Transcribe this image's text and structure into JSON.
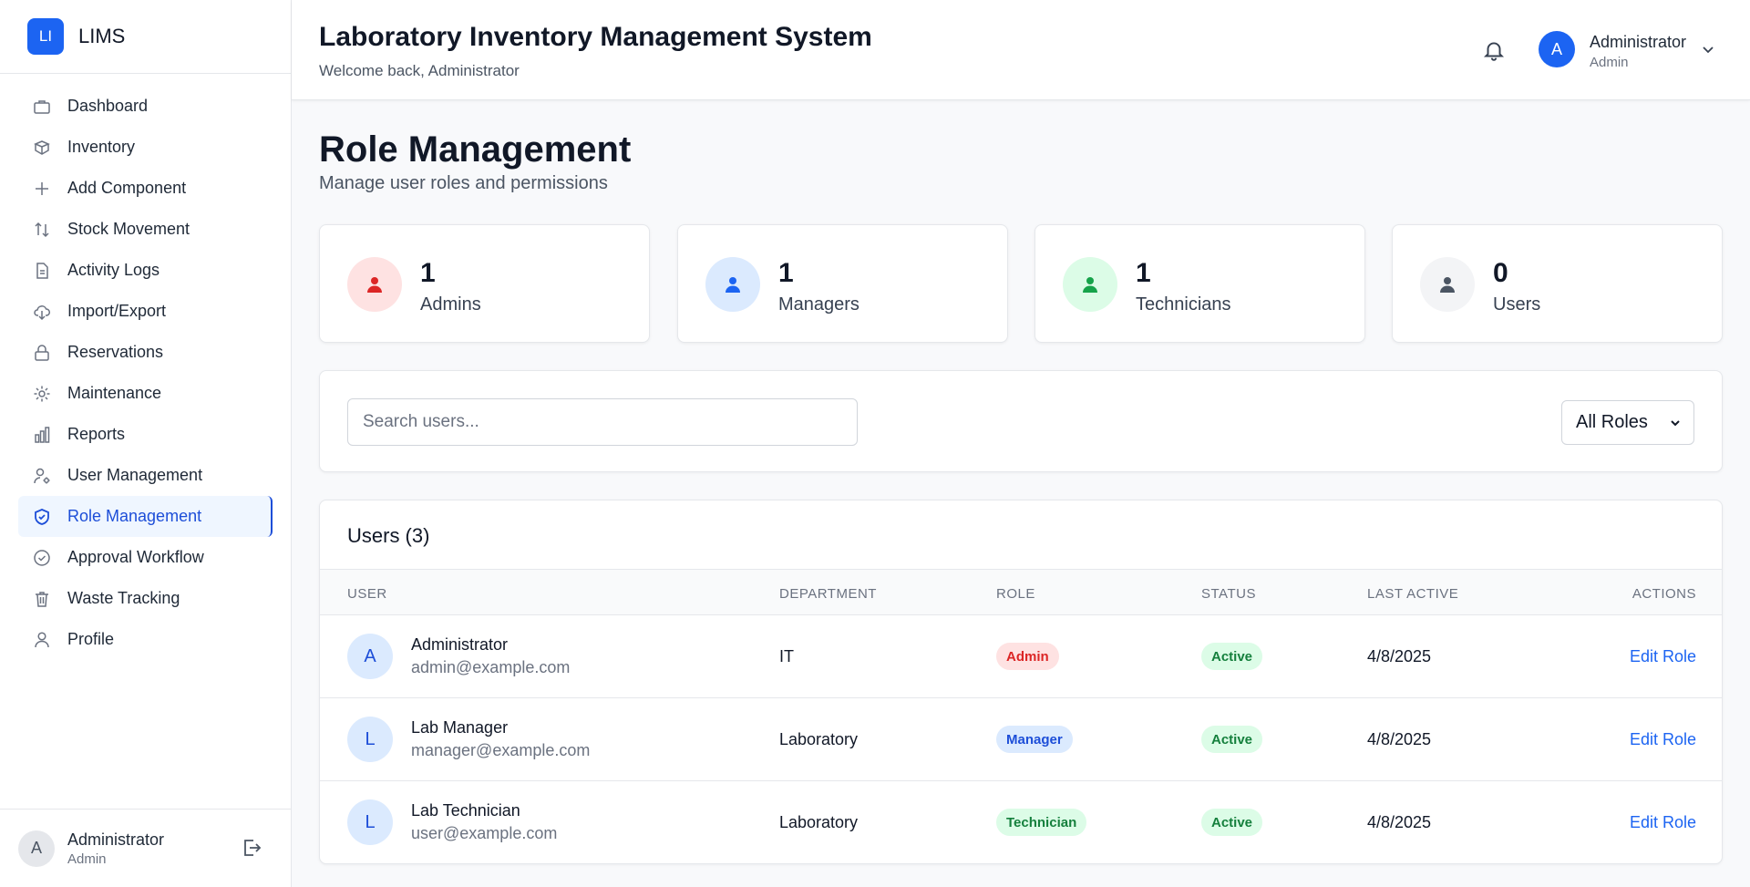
{
  "app": {
    "logo_text": "LI",
    "name": "LIMS"
  },
  "sidebar": {
    "items": [
      {
        "label": "Dashboard",
        "icon": "briefcase-icon"
      },
      {
        "label": "Inventory",
        "icon": "box-icon"
      },
      {
        "label": "Add Component",
        "icon": "plus-icon"
      },
      {
        "label": "Stock Movement",
        "icon": "arrows-up-down-icon"
      },
      {
        "label": "Activity Logs",
        "icon": "document-icon"
      },
      {
        "label": "Import/Export",
        "icon": "cloud-download-icon"
      },
      {
        "label": "Reservations",
        "icon": "lock-icon"
      },
      {
        "label": "Maintenance",
        "icon": "gear-icon"
      },
      {
        "label": "Reports",
        "icon": "bar-chart-icon"
      },
      {
        "label": "User Management",
        "icon": "user-cog-icon"
      },
      {
        "label": "Role Management",
        "icon": "shield-check-icon",
        "active": true
      },
      {
        "label": "Approval Workflow",
        "icon": "check-circle-icon"
      },
      {
        "label": "Waste Tracking",
        "icon": "trash-icon"
      },
      {
        "label": "Profile",
        "icon": "user-icon"
      }
    ],
    "footer": {
      "avatar": "A",
      "name": "Administrator",
      "role": "Admin"
    }
  },
  "header": {
    "title": "Laboratory Inventory Management System",
    "subtitle": "Welcome back, Administrator",
    "user": {
      "avatar": "A",
      "name": "Administrator",
      "role": "Admin"
    }
  },
  "page": {
    "title": "Role Management",
    "subtitle": "Manage user roles and permissions"
  },
  "stats": [
    {
      "count": "1",
      "label": "Admins",
      "bg": "#fee2e2",
      "fg": "#dc2626"
    },
    {
      "count": "1",
      "label": "Managers",
      "bg": "#dbeafe",
      "fg": "#1c64f2"
    },
    {
      "count": "1",
      "label": "Technicians",
      "bg": "#dcfce7",
      "fg": "#16a34a"
    },
    {
      "count": "0",
      "label": "Users",
      "bg": "#f3f4f6",
      "fg": "#4b5563"
    }
  ],
  "filters": {
    "search_placeholder": "Search users...",
    "role_selected": "All Roles"
  },
  "table": {
    "title": "Users (3)",
    "columns": [
      "USER",
      "DEPARTMENT",
      "ROLE",
      "STATUS",
      "LAST ACTIVE",
      "ACTIONS"
    ],
    "rows": [
      {
        "avatar": "A",
        "name": "Administrator",
        "email": "admin@example.com",
        "department": "IT",
        "role": "Admin",
        "status": "Active",
        "last_active": "4/8/2025",
        "action": "Edit Role"
      },
      {
        "avatar": "L",
        "name": "Lab Manager",
        "email": "manager@example.com",
        "department": "Laboratory",
        "role": "Manager",
        "status": "Active",
        "last_active": "4/8/2025",
        "action": "Edit Role"
      },
      {
        "avatar": "L",
        "name": "Lab Technician",
        "email": "user@example.com",
        "department": "Laboratory",
        "role": "Technician",
        "status": "Active",
        "last_active": "4/8/2025",
        "action": "Edit Role"
      }
    ]
  },
  "colors": {
    "accent": "#1c64f2",
    "admin_badge_bg": "#fee2e2",
    "admin_badge_fg": "#dc2626",
    "manager_badge_bg": "#dbeafe",
    "manager_badge_fg": "#1d4ed8",
    "technician_badge_bg": "#dcfce7",
    "technician_badge_fg": "#15803d",
    "status_active_bg": "#dcfce7",
    "status_active_fg": "#15803d"
  }
}
